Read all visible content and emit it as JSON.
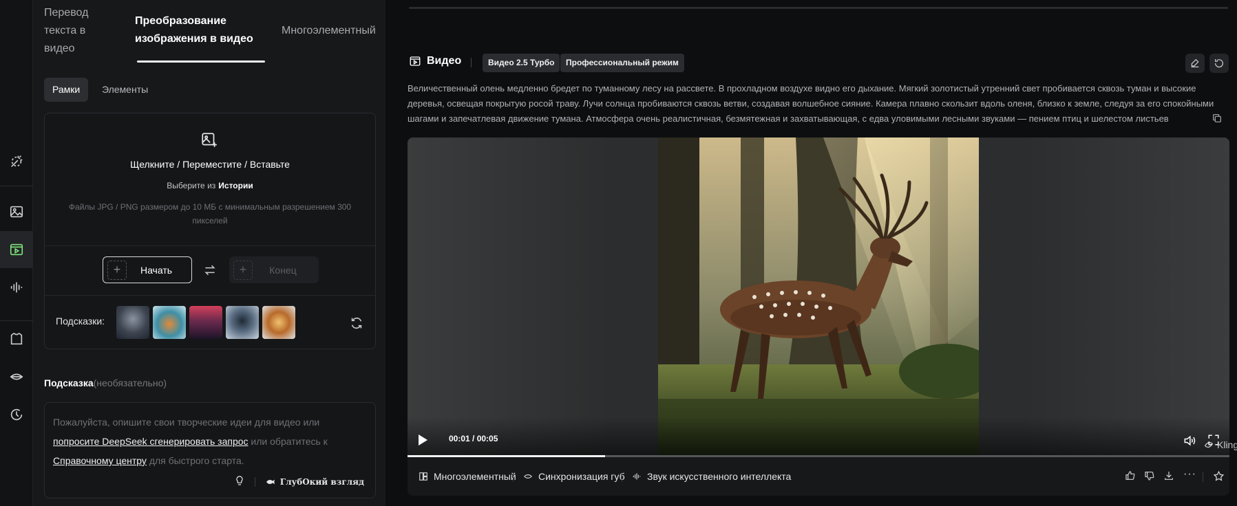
{
  "tabs": {
    "text_to_video": "Перевод текста в видео",
    "image_to_video": "Преобразование изображения в видео",
    "multi_element": "Многоэлементный"
  },
  "subtabs": {
    "frames": "Рамки",
    "elements": "Элементы"
  },
  "upload": {
    "main": "Щелкните / Переместите / Вставьте",
    "choose_from": "Выберите из",
    "history": "Истории",
    "file_info": "Файлы JPG / PNG размером до 10 МБ с минимальным разрешением 300 пикселей"
  },
  "frames": {
    "start": "Начать",
    "end": "Конец"
  },
  "hints": {
    "label": "Подсказки:"
  },
  "prompt": {
    "title": "Подсказка",
    "optional": "(необязательно)",
    "line1": "Пожалуйста, опишите свои творческие идеи для видео или ",
    "link1": "попросите DeepSeek сгенерировать запрос",
    "line2": " или обратитесь к ",
    "link2": "Справочному центру",
    "line3": " для быстрого старта.",
    "deep_look": "ГлубОкий взгляд"
  },
  "video": {
    "title": "Видео",
    "model_badge": "Видео 2.5 Турбо",
    "mode_badge": "Профессиональный режим",
    "description": "Величественный олень медленно бредет по туманному лесу на рассвете. В прохладном воздухе видно его дыхание. Мягкий золотистый утренний свет пробивается сквозь туман и высокие деревья, освещая покрытую росой траву. Лучи солнца пробиваются сквозь ветви, создавая волшебное сияние. Камера плавно скользит вдоль оленя, близко к земле, следуя за его спокойными шагами и запечатлевая движение тумана. Атмосфера очень реалистичная, безмятежная и захватывающая, с едва уловимыми лесными звуками — пением птиц и шелестом листьев",
    "time": "00:01 / 00:05",
    "progress": 0.24,
    "watermark": "KlingAI"
  },
  "actions": {
    "multi_element": "Многоэлементный",
    "lip_sync": "Синхронизация губ",
    "ai_sound": "Звук искусственного интеллекта"
  },
  "colors": {
    "accent_green": "#7ee37b",
    "panel_bg": "#17181a",
    "main_bg": "#0d0e10"
  }
}
